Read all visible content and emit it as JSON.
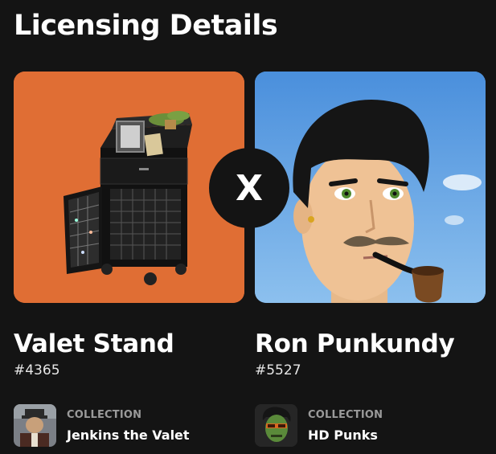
{
  "page": {
    "title": "Licensing Details"
  },
  "separator": {
    "symbol": "X"
  },
  "left_item": {
    "name": "Valet Stand",
    "id": "#4365",
    "image_icon": "valet-stand-cabinet",
    "bg_color": "#e06e34",
    "collection": {
      "caption": "COLLECTION",
      "name": "Jenkins the Valet",
      "thumb_icon": "jenkins-valet-avatar"
    }
  },
  "right_item": {
    "name": "Ron Punkundy",
    "id": "#5527",
    "image_icon": "ron-punkundy-portrait",
    "bg_color": "#5a9be0",
    "collection": {
      "caption": "COLLECTION",
      "name": "HD Punks",
      "thumb_icon": "hd-punk-avatar"
    }
  }
}
